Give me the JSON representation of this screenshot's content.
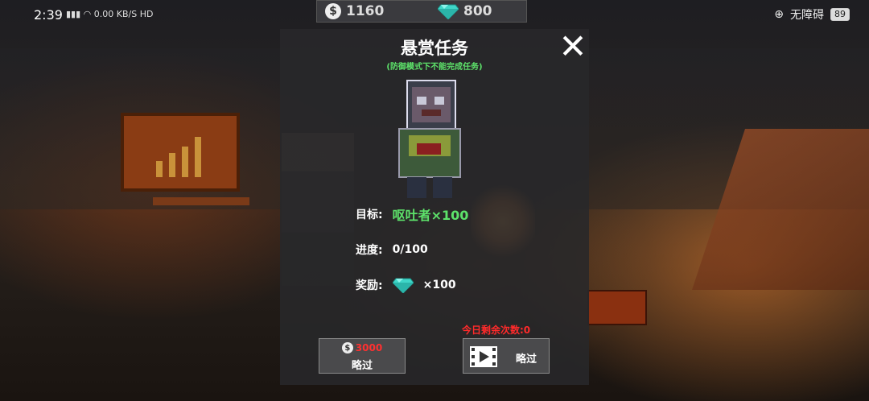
{
  "status_bar": {
    "time": "2:39",
    "network_text": "0.00 KB/S HD",
    "accessibility_label": "无障碍",
    "battery": "89"
  },
  "currency": {
    "coins": "1160",
    "gems": "800"
  },
  "modal": {
    "title": "悬赏任务",
    "subtitle": "(防御模式下不能完成任务)",
    "target_label": "目标:",
    "target_value": "呕吐者×100",
    "progress_label": "进度:",
    "progress_value": "0/100",
    "reward_label": "奖励:",
    "reward_value": "×100",
    "remaining_today": "今日剩余次数:0",
    "skip_coin_price": "3000",
    "skip_coin_label": "略过",
    "skip_video_label": "略过"
  },
  "colors": {
    "accent_green": "#5de26a",
    "warning_red": "#ff2a2a",
    "gem_cyan": "#3fd6c8"
  }
}
